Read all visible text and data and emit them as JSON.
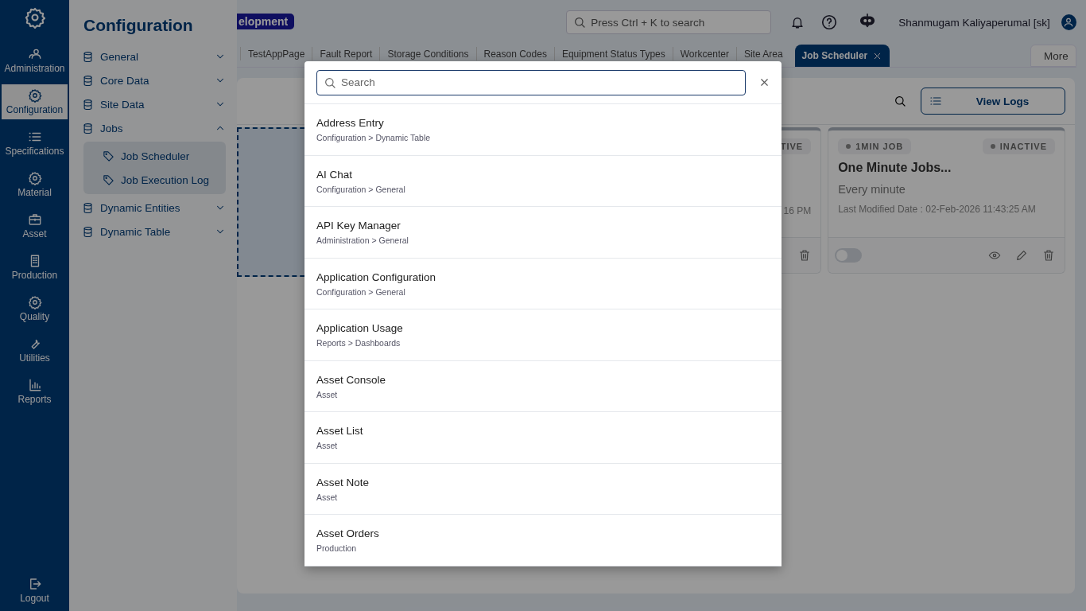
{
  "rail": {
    "items": [
      {
        "label": "Administration",
        "selected": false
      },
      {
        "label": "Configuration",
        "selected": true
      },
      {
        "label": "Specifications",
        "selected": false
      },
      {
        "label": "Material",
        "selected": false
      },
      {
        "label": "Asset",
        "selected": false
      },
      {
        "label": "Production",
        "selected": false
      },
      {
        "label": "Quality",
        "selected": false
      },
      {
        "label": "Utilities",
        "selected": false
      },
      {
        "label": "Reports",
        "selected": false
      }
    ],
    "logout": "Logout"
  },
  "flyout": {
    "title": "Configuration",
    "groups": [
      {
        "label": "General",
        "expanded": false
      },
      {
        "label": "Core Data",
        "expanded": false
      },
      {
        "label": "Site Data",
        "expanded": false
      },
      {
        "label": "Jobs",
        "expanded": true,
        "children": [
          {
            "label": "Job Scheduler"
          },
          {
            "label": "Job Execution Log"
          }
        ]
      },
      {
        "label": "Dynamic Entities",
        "expanded": false
      },
      {
        "label": "Dynamic Table",
        "expanded": false
      }
    ]
  },
  "header": {
    "env_badge": "elopment",
    "search": {
      "placeholder": "Press Ctrl + K to search"
    },
    "user": "Shanmugam Kaliyaperumal [sk]"
  },
  "tabs": [
    {
      "label": "TestAppPage",
      "selected": false
    },
    {
      "label": "Fault Report",
      "selected": false
    },
    {
      "label": "Storage Conditions",
      "selected": false
    },
    {
      "label": "Reason Codes",
      "selected": false
    },
    {
      "label": "Equipment Status Types",
      "selected": false
    },
    {
      "label": "Workcenter",
      "selected": false
    },
    {
      "label": "Site Area",
      "selected": false
    },
    {
      "label": "Job Scheduler",
      "selected": true
    }
  ],
  "more": "More",
  "toolbar": {
    "view_logs": "View Logs"
  },
  "cards": [
    {
      "kind": "dashed"
    },
    {
      "kind": "partial",
      "status": "TIVE",
      "date_tail": "16 PM"
    },
    {
      "kind": "full",
      "tag": "1MIN JOB",
      "status": "INACTIVE",
      "title": "One Minute Jobs...",
      "schedule": "Every minute",
      "modified": "Last Modified Date : 02-Feb-2026 11:43:25 AM",
      "on": false
    }
  ],
  "modal": {
    "search": {
      "placeholder": "Search"
    },
    "results": [
      {
        "title": "Address Entry",
        "path": "Configuration > Dynamic Table"
      },
      {
        "title": "AI Chat",
        "path": "Configuration > General"
      },
      {
        "title": "API Key Manager",
        "path": "Administration > General"
      },
      {
        "title": "Application Configuration",
        "path": "Configuration > General"
      },
      {
        "title": "Application Usage",
        "path": "Reports > Dashboards"
      },
      {
        "title": "Asset Console",
        "path": "Asset"
      },
      {
        "title": "Asset List",
        "path": "Asset"
      },
      {
        "title": "Asset Note",
        "path": "Asset"
      },
      {
        "title": "Asset Orders",
        "path": "Production"
      }
    ]
  }
}
